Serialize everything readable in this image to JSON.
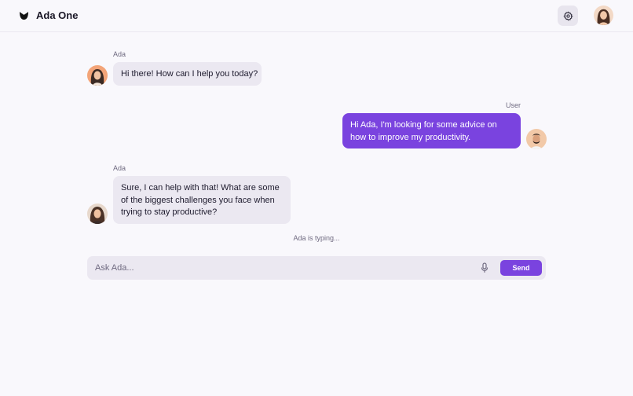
{
  "header": {
    "app_title": "Ada One",
    "logo_icon": "leaf-logo-icon",
    "settings_icon": "gear-icon"
  },
  "messages": [
    {
      "role": "assistant",
      "sender": "Ada",
      "text": "Hi there! How can I help you today?"
    },
    {
      "role": "user",
      "sender": "User",
      "text": "Hi Ada, I'm looking for some advice on how to improve my productivity."
    },
    {
      "role": "assistant",
      "sender": "Ada",
      "text": "Sure, I can help with that! What are some of the biggest challenges you face when trying to stay productive?"
    }
  ],
  "status": {
    "typing": "Ada is typing..."
  },
  "composer": {
    "placeholder": "Ask Ada...",
    "value": "",
    "mic_icon": "microphone-icon",
    "send_label": "Send"
  },
  "colors": {
    "accent": "#7a43df",
    "background": "#f9f8fc",
    "assistant_bubble": "#ebe8f1"
  }
}
